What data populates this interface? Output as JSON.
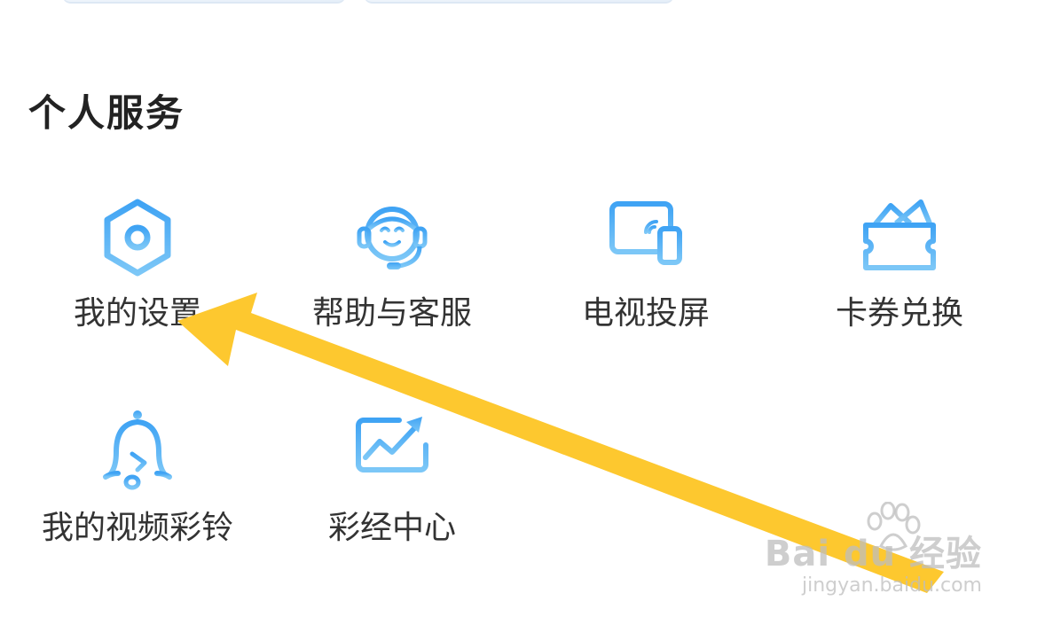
{
  "section": {
    "title": "个人服务"
  },
  "services": [
    {
      "label": "我的设置",
      "icon": "settings-hexagon-icon"
    },
    {
      "label": "帮助与客服",
      "icon": "customer-service-headset-icon"
    },
    {
      "label": "电视投屏",
      "icon": "tv-cast-icon"
    },
    {
      "label": "卡券兑换",
      "icon": "coupon-ticket-icon"
    },
    {
      "label": "我的视频彩铃",
      "icon": "bell-music-icon"
    },
    {
      "label": "彩经中心",
      "icon": "trend-chart-icon"
    }
  ],
  "annotation": {
    "arrow_color": "#FDC82F",
    "points_to": "我的设置"
  },
  "watermark": {
    "main": "Bai du 经验",
    "sub": "jingyan.baidu.com"
  },
  "colors": {
    "icon_gradient_start": "#45A8F5",
    "icon_gradient_end": "#7DC8F7",
    "text": "#333333"
  }
}
